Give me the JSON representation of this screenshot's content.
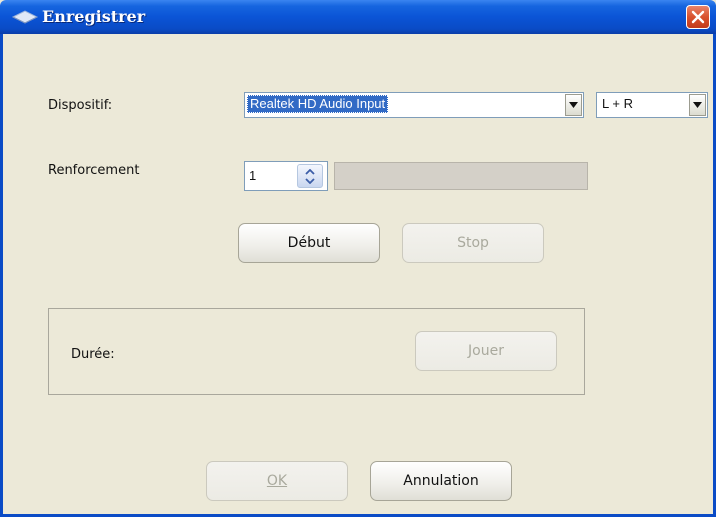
{
  "window": {
    "title": "Enregistrer"
  },
  "device": {
    "label": "Dispositif:",
    "selected": "Realtek HD Audio Input",
    "channel": "L + R"
  },
  "boost": {
    "label": "Renforcement",
    "value": "1"
  },
  "buttons": {
    "start": "Début",
    "stop": "Stop",
    "play": "Jouer",
    "ok": "OK",
    "cancel": "Annulation"
  },
  "duration": {
    "label": "Durée:"
  }
}
